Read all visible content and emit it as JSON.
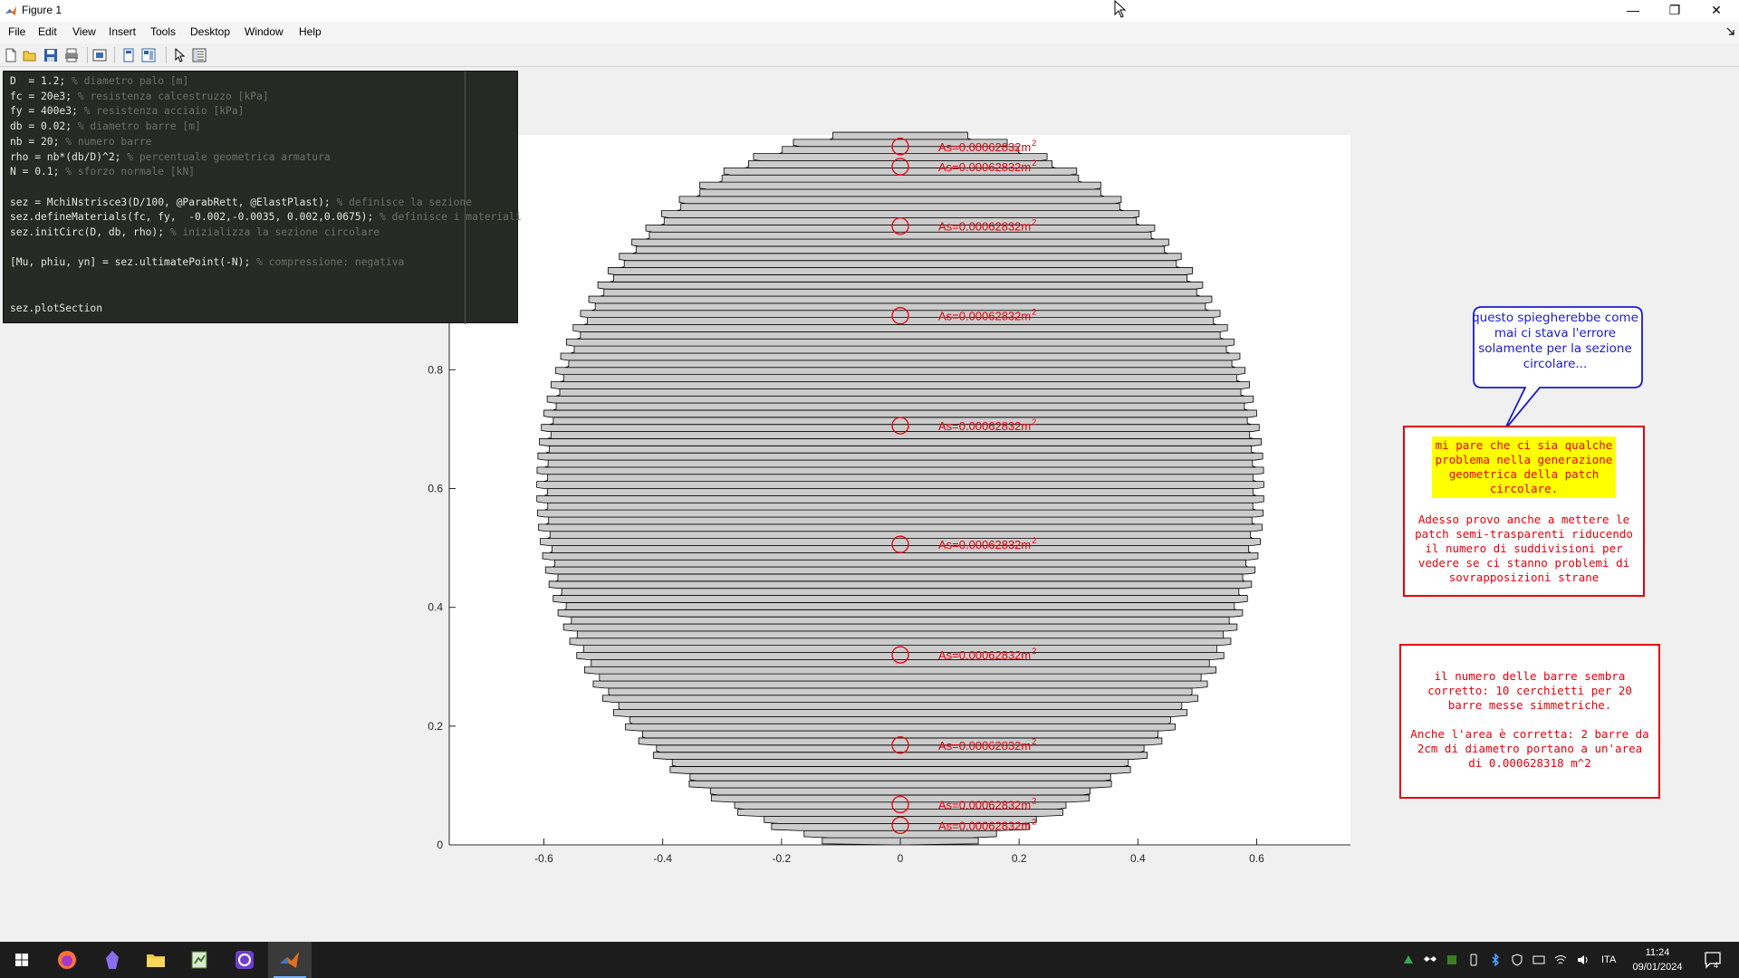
{
  "window": {
    "title": "Figure 1",
    "controls": {
      "minimize": "—",
      "restore": "❐",
      "close": "✕"
    }
  },
  "menubar": {
    "items": [
      "File",
      "Edit",
      "View",
      "Insert",
      "Tools",
      "Desktop",
      "Window",
      "Help"
    ]
  },
  "toolbar": {
    "icons": [
      "new-figure-icon",
      "open-file-icon",
      "save-icon",
      "print-icon",
      "link-plot-icon",
      "hide-plot-tools-icon",
      "show-plot-tools-icon",
      "edit-plot-icon",
      "property-inspector-icon"
    ]
  },
  "code_panel": {
    "lines": [
      {
        "code": "D  = 1.2; ",
        "comment": "% diametro palo [m]"
      },
      {
        "code": "fc = 20e3; ",
        "comment": "% resistenza calcestruzzo [kPa]"
      },
      {
        "code": "fy = 400e3; ",
        "comment": "% resistenza acciaio [kPa]"
      },
      {
        "code": "db = 0.02; ",
        "comment": "% diametro barre [m]"
      },
      {
        "code": "nb = 20; ",
        "comment": "% numero barre"
      },
      {
        "code": "rho = nb*(db/D)^2; ",
        "comment": "% percentuale geometrica armatura"
      },
      {
        "code": "N = 0.1; ",
        "comment": "% sforzo normale [kN]"
      },
      {
        "code": "",
        "comment": ""
      },
      {
        "code": "sez = MchiNstrisce3(D/100, @ParabRett, @ElastPlast); ",
        "comment": "% definisce la sezione"
      },
      {
        "code": "sez.defineMaterials(fc, fy,  -0.002,-0.0035, 0.002,0.0675); ",
        "comment": "% definisce i materiali"
      },
      {
        "code": "sez.initCirc(D, db, rho); ",
        "comment": "% inizializza la sezione circolare"
      },
      {
        "code": "",
        "comment": ""
      },
      {
        "code": "[Mu, phiu, yn] = sez.ultimatePoint(-N); ",
        "comment": "% compressione: negativa"
      },
      {
        "code": "",
        "comment": ""
      },
      {
        "code": "",
        "comment": ""
      },
      {
        "code": "sez.plotSection",
        "comment": ""
      }
    ]
  },
  "notes": {
    "bubble": "questo spiegherebbe come mai ci stava l'errore solamente per la sezione circolare...",
    "note1_highlight": [
      "mi pare che ci sia qualche",
      "problema nella generazione",
      "geometrica della patch",
      "circolare."
    ],
    "note1_body": [
      "Adesso provo anche a mettere le",
      "patch semi-trasparenti riducendo",
      "il numero di suddivisioni per",
      "vedere se ci stanno problemi di",
      "sovrapposizioni strane"
    ],
    "note2_body": [
      "il numero delle barre sembra",
      "corretto: 10 cerchietti per 20",
      "barre messe simmetriche.",
      "",
      "Anche l'area è corretta: 2 barre da",
      "2cm di diametro portano a un'area",
      "di 0.000628318 m^2"
    ]
  },
  "chart_data": {
    "type": "patch",
    "xlim": [
      -0.76,
      0.76
    ],
    "ylim": [
      0,
      1.2
    ],
    "xticks": [
      "-0.6",
      "-0.4",
      "-0.2",
      "0",
      "0.2",
      "0.4",
      "0.6"
    ],
    "yticks": [
      "0",
      "0.2",
      "0.4",
      "0.6",
      "0.8"
    ],
    "section_diameter": 1.2,
    "strip_height": 0.012,
    "strip_color": "#cccccc",
    "bar_color": "#e8000b",
    "bar_label": "As=0.00062832m",
    "bar_label_exp": "2",
    "bar_y": [
      1.176,
      1.142,
      1.042,
      0.891,
      0.706,
      0.506,
      0.32,
      0.168,
      0.068,
      0.033
    ]
  },
  "taskbar": {
    "time": "11:24",
    "date": "09/01/2024",
    "lang": "ITA",
    "notif_count": "4"
  }
}
